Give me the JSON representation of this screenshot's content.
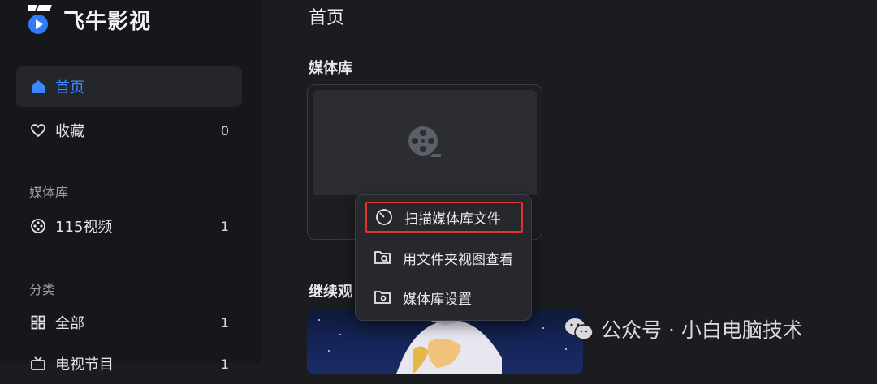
{
  "app": {
    "name": "飞牛影视"
  },
  "sidebar": {
    "nav": [
      {
        "label": "首页",
        "active": true,
        "icon": "home-icon"
      },
      {
        "label": "收藏",
        "count": "0",
        "icon": "heart-icon"
      }
    ],
    "section_media": "媒体库",
    "media_items": [
      {
        "label": "115视频",
        "count": "1",
        "icon": "film-reel-icon"
      }
    ],
    "section_category": "分类",
    "category_items": [
      {
        "label": "全部",
        "count": "1",
        "icon": "grid-icon"
      },
      {
        "label": "电视节目",
        "count": "1",
        "icon": "tv-icon"
      }
    ]
  },
  "main": {
    "title": "首页",
    "library_section": "媒体库",
    "continue_section": "继续观"
  },
  "context_menu": {
    "items": [
      {
        "label": "扫描媒体库文件",
        "icon": "scan-icon",
        "highlighted": true
      },
      {
        "label": "用文件夹视图查看",
        "icon": "folder-search-icon"
      },
      {
        "label": "媒体库设置",
        "icon": "folder-settings-icon"
      }
    ]
  },
  "watermark": {
    "text": "公众号 · 小白电脑技术"
  },
  "colors": {
    "accent": "#3b87ff",
    "highlight_border": "#e3342f",
    "background": "#1b1c1f",
    "sidebar": "#16171a"
  }
}
